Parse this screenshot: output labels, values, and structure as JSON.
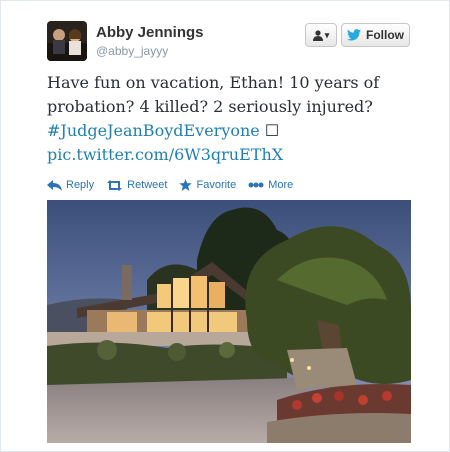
{
  "user": {
    "display_name": "Abby Jennings",
    "handle": "@abby_jayyy"
  },
  "buttons": {
    "user_menu_caret": "▾",
    "follow_label": "Follow"
  },
  "tweet": {
    "line1": "Have fun on vacation, Ethan! 10 years of",
    "line2": "probation? 4 killed? 2 seriously injured?",
    "hashtag": "#JudgeJeanBoydEveryone",
    "trailing_glyph": "☐",
    "pic_link": "pic.twitter.com/6W3qruEThX"
  },
  "actions": {
    "reply": "Reply",
    "retweet": "Retweet",
    "favorite": "Favorite",
    "more": "More"
  },
  "colors": {
    "link": "#1f7fb6",
    "action": "#2a73b8",
    "follow_bird": "#2aa9e0"
  },
  "icons": {
    "avatar": "profile-photo",
    "user_menu": "person-icon",
    "follow": "twitter-bird-icon",
    "reply": "reply-arrow-icon",
    "retweet": "retweet-icon",
    "favorite": "star-icon",
    "more": "dots-icon"
  }
}
